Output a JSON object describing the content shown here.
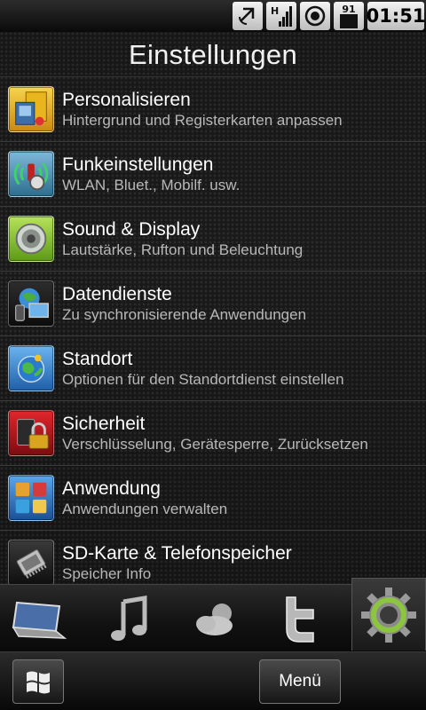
{
  "status_bar": {
    "icons": [
      "sync-icon",
      "signal-icon",
      "gps-icon",
      "battery-icon"
    ],
    "signal_type": "H",
    "battery_level": "91",
    "time": "01:51"
  },
  "header": {
    "title": "Einstellungen"
  },
  "settings": [
    {
      "title": "Personalisieren",
      "subtitle": "Hintergrund und Registerkarten anpassen",
      "icon": "personalize-icon"
    },
    {
      "title": "Funkeinstellungen",
      "subtitle": "WLAN, Bluet., Mobilf. usw.",
      "icon": "wireless-icon"
    },
    {
      "title": "Sound & Display",
      "subtitle": "Lautstärke, Rufton und Beleuchtung",
      "icon": "speaker-icon"
    },
    {
      "title": "Datendienste",
      "subtitle": "Zu synchronisierende Anwendungen",
      "icon": "data-sync-icon"
    },
    {
      "title": "Standort",
      "subtitle": "Optionen für den Standortdienst einstellen",
      "icon": "globe-icon"
    },
    {
      "title": "Sicherheit",
      "subtitle": "Verschlüsselung, Gerätesperre, Zurücksetzen",
      "icon": "lock-icon"
    },
    {
      "title": "Anwendung",
      "subtitle": "Anwendungen verwalten",
      "icon": "apps-icon"
    },
    {
      "title": "SD-Karte & Telefonspeicher",
      "subtitle": "Speicher Info",
      "icon": "memory-chip-icon"
    }
  ],
  "tabs": [
    {
      "name": "laptop-icon"
    },
    {
      "name": "music-note-icon"
    },
    {
      "name": "weather-icon"
    },
    {
      "name": "twitter-icon"
    },
    {
      "name": "settings-gear-icon",
      "active": true
    }
  ],
  "bottom_bar": {
    "menu_label": "Menü"
  },
  "colors": {
    "accent_green": "#8cc63f",
    "background": "#1b1b1b"
  }
}
